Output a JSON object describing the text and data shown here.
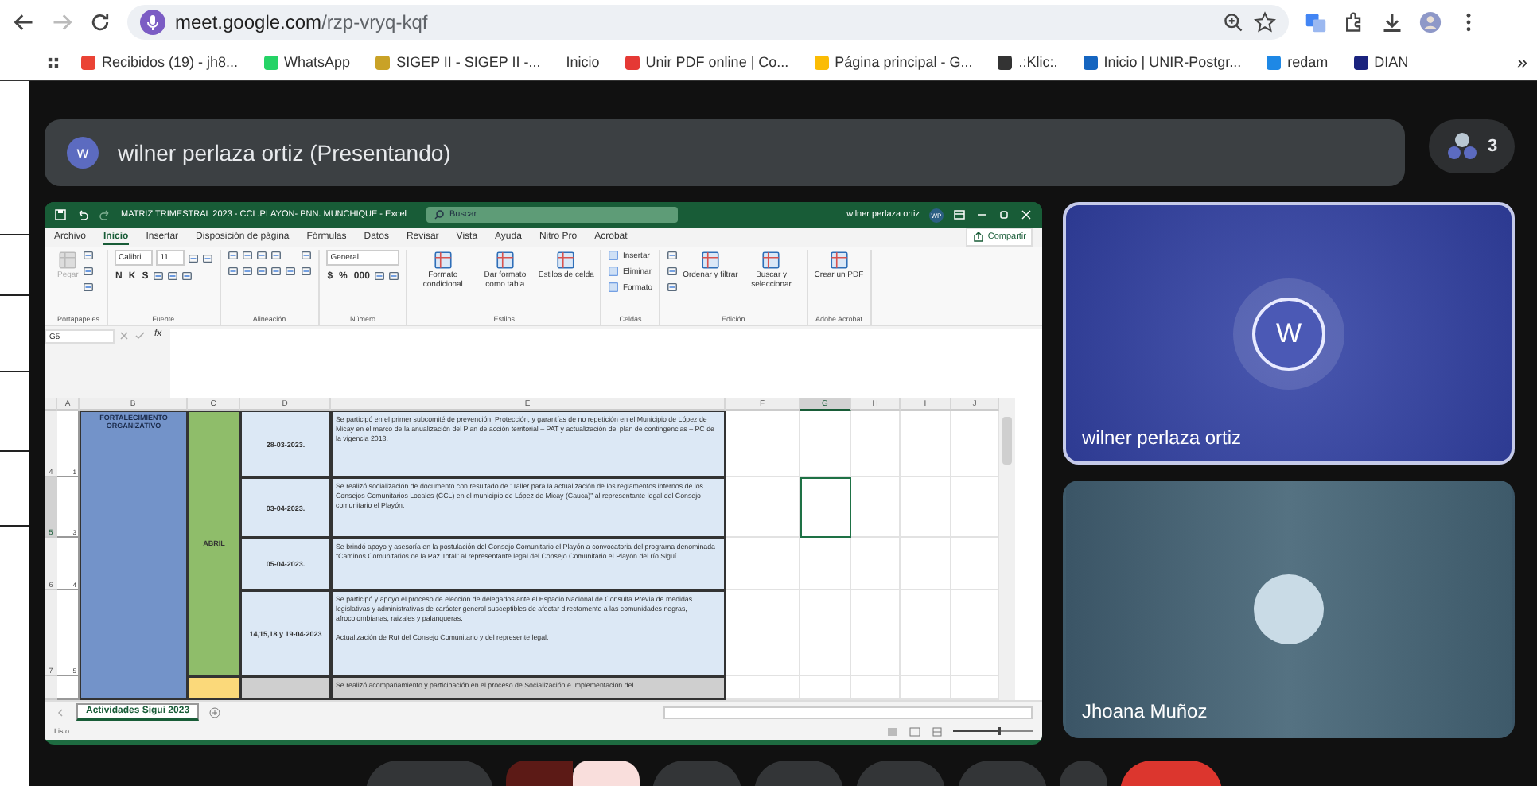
{
  "browser": {
    "url_host": "meet.google.com",
    "url_path": "/rzp-vryq-kqf",
    "bookmarks": [
      {
        "label": "Recibidos (19) - jh8...",
        "kind": "favicon"
      },
      {
        "label": "WhatsApp",
        "kind": "favicon"
      },
      {
        "label": "SIGEP II - SIGEP II -...",
        "kind": "favicon"
      },
      {
        "label": "Inicio",
        "kind": "text"
      },
      {
        "label": "Unir PDF online | Co...",
        "kind": "favicon"
      },
      {
        "label": "Página principal - G...",
        "kind": "favicon"
      },
      {
        "label": ".:Klic:.",
        "kind": "favicon"
      },
      {
        "label": "Inicio | UNIR-Postgr...",
        "kind": "favicon"
      },
      {
        "label": "redam",
        "kind": "favicon"
      },
      {
        "label": "DIAN",
        "kind": "favicon"
      }
    ],
    "overflow": "»"
  },
  "meet": {
    "presenter": {
      "initial": "w",
      "label": "wilner perlaza ortiz (Presentando)"
    },
    "participant_count": "3",
    "tiles": [
      {
        "name": "wilner perlaza ortiz",
        "kind": "initial",
        "initial": "W",
        "highlighted": true
      },
      {
        "name": "Jhoana Muñoz",
        "kind": "photo",
        "highlighted": false
      }
    ],
    "controls": [
      {
        "kind": "pill"
      },
      {
        "kind": "mic",
        "muted": true
      },
      {
        "kind": "round"
      },
      {
        "kind": "round"
      },
      {
        "kind": "round"
      },
      {
        "kind": "round"
      },
      {
        "kind": "small"
      },
      {
        "kind": "end_call"
      }
    ]
  },
  "excel": {
    "title": "MATRIZ TRIMESTRAL 2023 - CCL.PLAYON- PNN. MUNCHIQUE  -  Excel",
    "search": "Buscar",
    "user": "wilner perlaza ortiz",
    "user_initials": "WP",
    "tabs": [
      {
        "label": "Archivo",
        "selected": false
      },
      {
        "label": "Inicio",
        "selected": true
      },
      {
        "label": "Insertar",
        "selected": false
      },
      {
        "label": "Disposición de página",
        "selected": false
      },
      {
        "label": "Fórmulas",
        "selected": false
      },
      {
        "label": "Datos",
        "selected": false
      },
      {
        "label": "Revisar",
        "selected": false
      },
      {
        "label": "Vista",
        "selected": false
      },
      {
        "label": "Ayuda",
        "selected": false
      },
      {
        "label": "Nitro Pro",
        "selected": false
      },
      {
        "label": "Acrobat",
        "selected": false
      }
    ],
    "share": "Compartir",
    "groups": [
      {
        "label": "Portapapeles",
        "items": [
          {
            "kind": "large",
            "label": "Pegar",
            "disabled": true
          },
          {
            "kind": "stack",
            "parts": [
              {
                "kind": "icon"
              },
              {
                "kind": "icon"
              },
              {
                "kind": "icon"
              }
            ]
          }
        ]
      },
      {
        "label": "Fuente",
        "items": [
          {
            "kind": "stack",
            "parts": [
              {
                "kind": "row",
                "parts": [
                  {
                    "kind": "field",
                    "value": "Calibri"
                  },
                  {
                    "kind": "field",
                    "value": "11"
                  },
                  {
                    "kind": "icon"
                  },
                  {
                    "kind": "icon"
                  }
                ]
              },
              {
                "kind": "row",
                "parts": [
                  {
                    "kind": "key",
                    "label": "N"
                  },
                  {
                    "kind": "key",
                    "label": "K"
                  },
                  {
                    "kind": "key",
                    "label": "S"
                  },
                  {
                    "kind": "icon"
                  },
                  {
                    "kind": "icon"
                  },
                  {
                    "kind": "icon"
                  }
                ]
              }
            ]
          }
        ]
      },
      {
        "label": "Alineación",
        "items": [
          {
            "kind": "stack",
            "parts": [
              {
                "kind": "row",
                "parts": [
                  {
                    "kind": "icon"
                  },
                  {
                    "kind": "icon"
                  },
                  {
                    "kind": "icon"
                  },
                  {
                    "kind": "icon"
                  }
                ]
              },
              {
                "kind": "row",
                "parts": [
                  {
                    "kind": "icon"
                  },
                  {
                    "kind": "icon"
                  },
                  {
                    "kind": "icon"
                  },
                  {
                    "kind": "icon"
                  },
                  {
                    "kind": "icon"
                  }
                ]
              }
            ]
          },
          {
            "kind": "stack",
            "parts": [
              {
                "kind": "icon"
              },
              {
                "kind": "icon"
              }
            ]
          }
        ]
      },
      {
        "label": "Número",
        "items": [
          {
            "kind": "stack",
            "parts": [
              {
                "kind": "field",
                "value": "General"
              },
              {
                "kind": "row",
                "parts": [
                  {
                    "kind": "key",
                    "label": "$"
                  },
                  {
                    "kind": "key",
                    "label": "%"
                  },
                  {
                    "kind": "key",
                    "label": "000"
                  },
                  {
                    "kind": "icon"
                  },
                  {
                    "kind": "icon"
                  }
                ]
              }
            ]
          }
        ]
      },
      {
        "label": "Estilos",
        "items": [
          {
            "kind": "large",
            "label": "Formato condicional",
            "disabled": false
          },
          {
            "kind": "large",
            "label": "Dar formato como tabla",
            "disabled": false
          },
          {
            "kind": "large",
            "label": "Estilos de celda",
            "disabled": false
          }
        ]
      },
      {
        "label": "Celdas",
        "items": [
          {
            "kind": "stack",
            "parts": [
              {
                "kind": "small",
                "label": "Insertar"
              },
              {
                "kind": "small",
                "label": "Eliminar"
              },
              {
                "kind": "small",
                "label": "Formato"
              }
            ]
          }
        ]
      },
      {
        "label": "Edición",
        "items": [
          {
            "kind": "stack",
            "parts": [
              {
                "kind": "icon"
              },
              {
                "kind": "icon"
              },
              {
                "kind": "icon"
              }
            ]
          },
          {
            "kind": "large",
            "label": "Ordenar y filtrar",
            "disabled": false
          },
          {
            "kind": "large",
            "label": "Buscar y seleccionar",
            "disabled": false
          }
        ]
      },
      {
        "label": "Adobe Acrobat",
        "items": [
          {
            "kind": "large",
            "label": "Crear un PDF",
            "disabled": false
          }
        ]
      }
    ],
    "name_box": "G5",
    "function_label": "fx",
    "columns": [
      {
        "letter": "A",
        "selected": false
      },
      {
        "letter": "B",
        "selected": false
      },
      {
        "letter": "C",
        "selected": false
      },
      {
        "letter": "D",
        "selected": false
      },
      {
        "letter": "E",
        "selected": false
      },
      {
        "letter": "F",
        "selected": false
      },
      {
        "letter": "G",
        "selected": true
      },
      {
        "letter": "H",
        "selected": false
      },
      {
        "letter": "I",
        "selected": false
      },
      {
        "letter": "J",
        "selected": false
      }
    ],
    "category": "FORTALECIMIENTO ORGANIZATIVO",
    "month": "ABRIL",
    "rows": [
      {
        "kind": "entry",
        "number": "4",
        "a": "1",
        "selected": false,
        "date": "28-03-2023.",
        "text": "Se participó en el primer subcomité de prevención, Protección, y garantías de no repetición en el Municipio de López de Micay en el marco de la anualización del Plan de acción territorial – PAT y actualización del plan de contingencias – PC de la vigencia 2013."
      },
      {
        "kind": "entry",
        "number": "5",
        "a": "3",
        "selected": true,
        "date": "03-04-2023.",
        "text": "Se realizó socialización de documento con resultado de \"Taller para la actualización de los reglamentos internos de los Consejos Comunitarios Locales (CCL) en el municipio de López de Micay (Cauca)\" al representante legal del Consejo comunitario el Playón."
      },
      {
        "kind": "entry",
        "number": "6",
        "a": "4",
        "selected": false,
        "date": "05-04-2023.",
        "text": "Se brindó apoyo y asesoría en la postulación del Consejo Comunitario el Playón a convocatoria del programa denominada \"Caminos Comunitarios de la Paz Total\" al representante legal del Consejo Comunitario el Playón del río Sigüí."
      },
      {
        "kind": "entry",
        "number": "7",
        "a": "5",
        "selected": false,
        "date": "14,15,18 y 19-04-2023",
        "text": "Se participó y apoyo el proceso de elección de delegados ante el Espacio Nacional de Consulta Previa de medidas legislativas y administrativas de carácter general susceptibles de afectar directamente a las comunidades negras, afrocolombianas, raizales y palanqueras.\n\nActualización de Rut del Consejo Comunitario y del represente legal."
      },
      {
        "kind": "next",
        "selected": false,
        "text": "Se realizó acompañamiento y participación en el proceso de Socialización e Implementación del"
      }
    ],
    "sheet_tabs": [
      {
        "label": "Actividades Sigui 2023",
        "selected": true
      }
    ],
    "status": "Listo",
    "zoom_slider": {
      "level": 0.55
    }
  }
}
